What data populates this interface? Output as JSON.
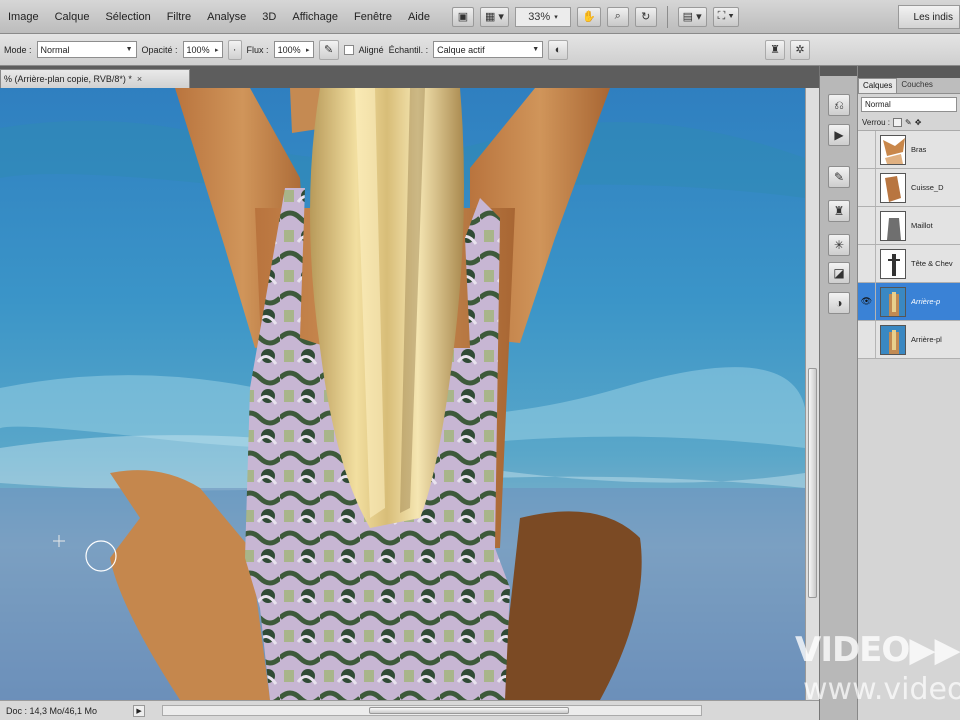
{
  "menubar": {
    "items": [
      "Image",
      "Calque",
      "Sélection",
      "Filtre",
      "Analyse",
      "3D",
      "Affichage",
      "Fenêtre",
      "Aide"
    ],
    "zoom": "33%",
    "workspace": "Les indis"
  },
  "options": {
    "mode_label": "Mode :",
    "mode_value": "Normal",
    "opacity_label": "Opacité :",
    "opacity_value": "100%",
    "flow_label": "Flux :",
    "flow_value": "100%",
    "aligned_label": "Aligné",
    "sample_label": "Échantil. :",
    "sample_value": "Calque actif"
  },
  "document": {
    "tab_title": "% (Arrière-plan copie, RVB/8*) *",
    "close_label": "×"
  },
  "status": {
    "doc_info": "Doc : 14,3 Mo/46,1 Mo"
  },
  "layers_panel": {
    "tabs": [
      "Calques",
      "Couches"
    ],
    "blend_mode": "Normal",
    "lock_label": "Verrou :",
    "layers": [
      {
        "name": "Bras",
        "selected": false,
        "visible": false
      },
      {
        "name": "Cuisse_D",
        "selected": false,
        "visible": false
      },
      {
        "name": "Maillot",
        "selected": false,
        "visible": false
      },
      {
        "name": "Tête & Chev",
        "selected": false,
        "visible": false
      },
      {
        "name": "Arrière-p",
        "selected": true,
        "visible": true
      },
      {
        "name": "Arrière-pl",
        "selected": false,
        "visible": false
      }
    ]
  },
  "watermark": {
    "line1": "VIDEO▶▶",
    "line2": "www.video"
  },
  "colors": {
    "selection_blue": "#3a82d6",
    "sea": "#3f86bf"
  }
}
